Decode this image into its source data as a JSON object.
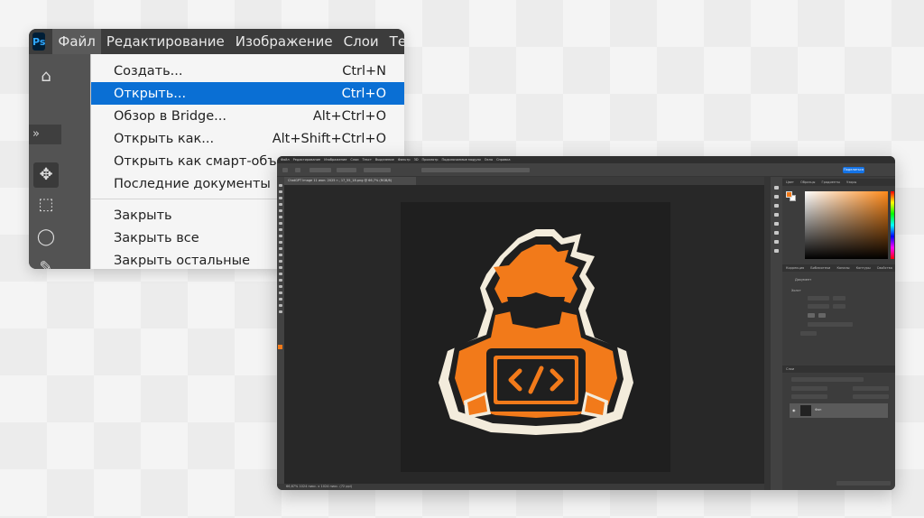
{
  "zoom_view": {
    "app_logo": "Ps",
    "menubar": [
      "Файл",
      "Редактирование",
      "Изображение",
      "Слои",
      "Те"
    ],
    "active_menu": "Файл",
    "dropdown": {
      "group1": [
        {
          "label": "Создать...",
          "shortcut": "Ctrl+N"
        },
        {
          "label": "Открыть...",
          "shortcut": "Ctrl+O",
          "highlighted": true
        },
        {
          "label": "Обзор в Bridge...",
          "shortcut": "Alt+Ctrl+O"
        },
        {
          "label": "Открыть как...",
          "shortcut": "Alt+Shift+Ctrl+O"
        },
        {
          "label": "Открыть как смарт-объект...",
          "shortcut": ""
        },
        {
          "label": "Последние документы",
          "shortcut": ""
        }
      ],
      "group2": [
        {
          "label": "Закрыть",
          "shortcut": ""
        },
        {
          "label": "Закрыть все",
          "shortcut": ""
        },
        {
          "label": "Закрыть остальные",
          "shortcut": ""
        }
      ]
    },
    "tool_icons": [
      "home-icon",
      "move-icon",
      "marquee-icon",
      "lasso-icon",
      "quick-select-icon",
      "crop-icon"
    ]
  },
  "ps_window": {
    "menubar": [
      "Файл",
      "Редактирование",
      "Изображение",
      "Слои",
      "Текст",
      "Выделение",
      "Фильтр",
      "3D",
      "Просмотр",
      "Подключаемые модули",
      "Окно",
      "Справка"
    ],
    "document_tab": "ChatGPT Image 11 июн. 2025 г., 17_55_18.png @ 66,7% (RGB/8)",
    "share_button": "Поделиться",
    "status_text": "66,67%    1024 пикс. x 1024 пикс. (72 ppi)",
    "panel_tabs_top": [
      "Цвет",
      "Образцы",
      "Градиенты",
      "Узоры"
    ],
    "panel_tabs_mid": [
      "Коррекция",
      "Библиотеки",
      "Каналы",
      "Контуры",
      "Свойства"
    ],
    "properties_label": "Документ",
    "canvas_section_label": "Холст",
    "layers_header": "Слои",
    "layer_name": "Фон",
    "accent_orange": "#f27a1a",
    "logo_cream": "#f3ecdc",
    "logo_dark": "#1f1f1f"
  }
}
